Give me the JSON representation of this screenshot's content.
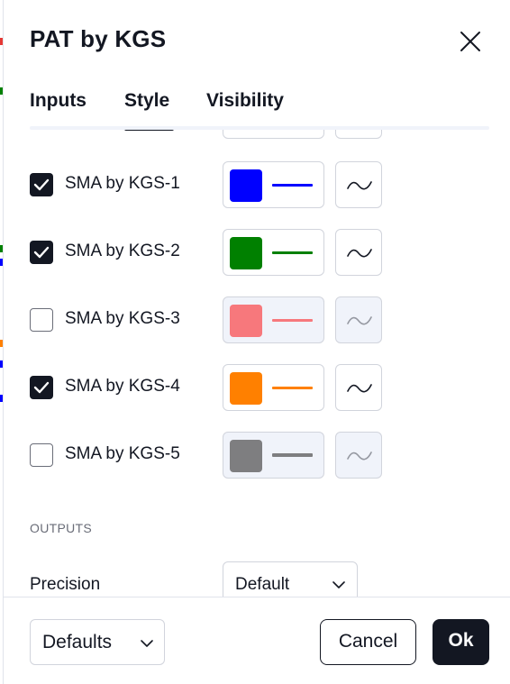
{
  "dialog": {
    "title": "PAT by KGS"
  },
  "tabs": [
    {
      "label": "Inputs",
      "active": false
    },
    {
      "label": "Style",
      "active": true
    },
    {
      "label": "Visibility",
      "active": false
    }
  ],
  "plots": [
    {
      "label": "SMA by KGS-1",
      "checked": true,
      "color": "#0000FF",
      "line_color": "#0000FF",
      "disabled": false
    },
    {
      "label": "SMA by KGS-2",
      "checked": true,
      "color": "#008000",
      "line_color": "#008000",
      "disabled": false
    },
    {
      "label": "SMA by KGS-3",
      "checked": false,
      "color": "#F7787C",
      "line_color": "#F7787C",
      "disabled": true
    },
    {
      "label": "SMA by KGS-4",
      "checked": true,
      "color": "#FF8000",
      "line_color": "#FF8000",
      "disabled": false
    },
    {
      "label": "SMA by KGS-5",
      "checked": false,
      "color": "#7E7E80",
      "line_color": "#7E7E80",
      "disabled": true
    }
  ],
  "outputs": {
    "section_title": "OUTPUTS",
    "precision_label": "Precision",
    "precision_value": "Default"
  },
  "footer": {
    "defaults_label": "Defaults",
    "cancel_label": "Cancel",
    "ok_label": "Ok"
  },
  "icons": {
    "close": "close-icon",
    "check": "check-icon",
    "plot_style": "line-wave-icon",
    "dropdown": "chevron-down-icon"
  },
  "colors": {
    "text": "#131722",
    "muted": "#6A6D78",
    "border": "#D1D4DC",
    "disabled_bg": "#F0F3FA",
    "primary": "#131722"
  }
}
